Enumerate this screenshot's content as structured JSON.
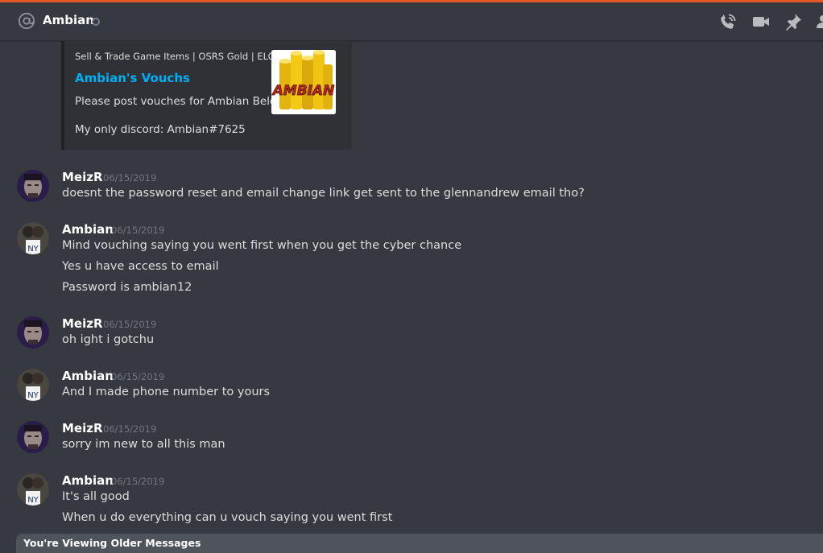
{
  "header": {
    "channel_name": "Ambian",
    "accent_color": "#e45727",
    "icons": [
      "at-icon",
      "phone-call-icon",
      "video-call-icon",
      "pin-icon",
      "member-list-icon"
    ]
  },
  "embed": {
    "provider": "Sell & Trade Game Items | OSRS Gold | ELO",
    "title": "Ambian's Vouchs",
    "description_1": "Please post vouches for Ambian Below!",
    "description_2": "My only discord: Ambian#7625",
    "thumbnail_text": "AMBIAN",
    "title_color": "#00b0f4"
  },
  "messages": [
    {
      "author": "MeizR",
      "timestamp": "06/15/2019",
      "lines": [
        "doesnt the password reset and email change link get sent to the glennandrew email tho?"
      ]
    },
    {
      "author": "Ambian",
      "timestamp": "06/15/2019",
      "lines": [
        "Mind vouching saying you went first when you get the cyber chance",
        "Yes u have access to email",
        "Password is ambian12"
      ]
    },
    {
      "author": "MeizR",
      "timestamp": "06/15/2019",
      "lines": [
        "oh ight i gotchu"
      ]
    },
    {
      "author": "Ambian",
      "timestamp": "06/15/2019",
      "lines": [
        "And I made phone number to yours"
      ]
    },
    {
      "author": "MeizR",
      "timestamp": "06/15/2019",
      "lines": [
        "sorry im new to all this man"
      ]
    },
    {
      "author": "Ambian",
      "timestamp": "06/15/2019",
      "lines": [
        "It's all good",
        "When u do everything can u vouch saying you went first"
      ]
    }
  ],
  "older_messages_bar": {
    "label": "You're Viewing Older Messages"
  }
}
